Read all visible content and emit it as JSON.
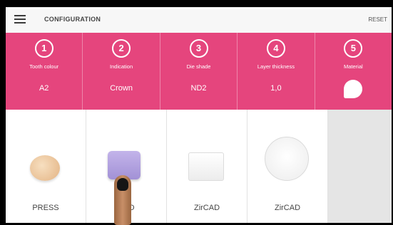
{
  "header": {
    "title": "CONFIGURATION",
    "reset_label": "RESET",
    "menu_icon": "hamburger-menu-icon"
  },
  "steps": [
    {
      "number": "1",
      "label": "Tooth colour",
      "value": "A2"
    },
    {
      "number": "2",
      "label": "Indication",
      "value": "Crown"
    },
    {
      "number": "3",
      "label": "Die shade",
      "value": "ND2"
    },
    {
      "number": "4",
      "label": "Layer thickness",
      "value": "1,0"
    },
    {
      "number": "5",
      "label": "Material",
      "value_icon": "tooth-icon"
    }
  ],
  "products": [
    {
      "label": "PRESS"
    },
    {
      "label": "CAD"
    },
    {
      "label": "ZirCAD"
    },
    {
      "label": "ZirCAD"
    }
  ],
  "colors": {
    "accent": "#e5457d",
    "header_bg": "#f7f7f7",
    "empty_card": "#e5e5e5"
  }
}
